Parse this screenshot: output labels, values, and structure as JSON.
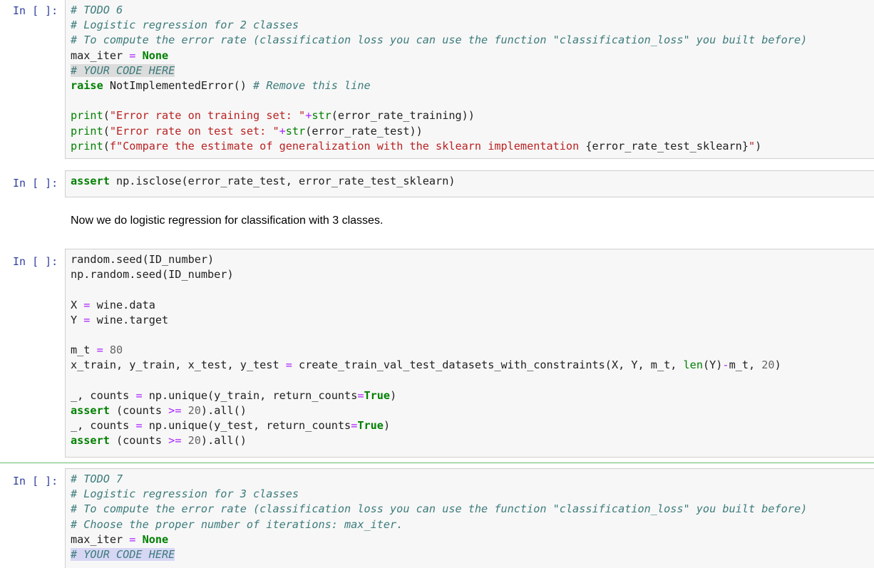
{
  "cells": [
    {
      "prompt": "In [ ]:",
      "lines": [
        [
          {
            "t": "# TODO 6",
            "c": "c"
          }
        ],
        [
          {
            "t": "# Logistic regression for 2 classes",
            "c": "c"
          }
        ],
        [
          {
            "t": "# To compute the error rate (classification loss you can use the function \"classification_loss\" you built before)",
            "c": "c"
          }
        ],
        [
          {
            "t": "max_iter "
          },
          {
            "t": "=",
            "c": "o"
          },
          {
            "t": " "
          },
          {
            "t": "None",
            "c": "k"
          }
        ],
        [
          {
            "t": "# YOUR CODE HERE",
            "c": "c hl"
          }
        ],
        [
          {
            "t": "raise",
            "c": "k"
          },
          {
            "t": " NotImplementedError() "
          },
          {
            "t": "# Remove this line",
            "c": "c"
          }
        ],
        [
          {
            "t": ""
          }
        ],
        [
          {
            "t": "print",
            "c": "b"
          },
          {
            "t": "("
          },
          {
            "t": "\"Error rate on training set: \"",
            "c": "s"
          },
          {
            "t": "+",
            "c": "o"
          },
          {
            "t": "str",
            "c": "b"
          },
          {
            "t": "(error_rate_training))"
          }
        ],
        [
          {
            "t": "print",
            "c": "b"
          },
          {
            "t": "("
          },
          {
            "t": "\"Error rate on test set: \"",
            "c": "s"
          },
          {
            "t": "+",
            "c": "o"
          },
          {
            "t": "str",
            "c": "b"
          },
          {
            "t": "(error_rate_test))"
          }
        ],
        [
          {
            "t": "print",
            "c": "b"
          },
          {
            "t": "("
          },
          {
            "t": "f\"Compare the estimate of generalization with the sklearn implementation ",
            "c": "s"
          },
          {
            "t": "{error_rate_test_sklearn}"
          },
          {
            "t": "\"",
            "c": "s"
          },
          {
            "t": ")"
          }
        ]
      ]
    },
    {
      "prompt": "In [ ]:",
      "lines": [
        [
          {
            "t": "assert",
            "c": "k"
          },
          {
            "t": " np.isclose(error_rate_test, error_rate_test_sklearn)"
          }
        ]
      ]
    },
    {
      "markdown": "Now we do logistic regression for classification with 3 classes."
    },
    {
      "prompt": "In [ ]:",
      "lines": [
        [
          {
            "t": "random.seed(ID_number)"
          }
        ],
        [
          {
            "t": "np.random.seed(ID_number)"
          }
        ],
        [
          {
            "t": ""
          }
        ],
        [
          {
            "t": "X "
          },
          {
            "t": "=",
            "c": "o"
          },
          {
            "t": " wine.data"
          }
        ],
        [
          {
            "t": "Y "
          },
          {
            "t": "=",
            "c": "o"
          },
          {
            "t": " wine.target"
          }
        ],
        [
          {
            "t": ""
          }
        ],
        [
          {
            "t": "m_t "
          },
          {
            "t": "=",
            "c": "o"
          },
          {
            "t": " "
          },
          {
            "t": "80",
            "c": "n"
          }
        ],
        [
          {
            "t": "x_train, y_train, x_test, y_test "
          },
          {
            "t": "=",
            "c": "o"
          },
          {
            "t": " create_train_val_test_datasets_with_constraints(X, Y, m_t, "
          },
          {
            "t": "len",
            "c": "b"
          },
          {
            "t": "(Y)"
          },
          {
            "t": "-",
            "c": "o"
          },
          {
            "t": "m_t, "
          },
          {
            "t": "20",
            "c": "n"
          },
          {
            "t": ")"
          }
        ],
        [
          {
            "t": ""
          }
        ],
        [
          {
            "t": "_, counts "
          },
          {
            "t": "=",
            "c": "o"
          },
          {
            "t": " np.unique(y_train, return_counts"
          },
          {
            "t": "=",
            "c": "o"
          },
          {
            "t": "True",
            "c": "k"
          },
          {
            "t": ")"
          }
        ],
        [
          {
            "t": "assert",
            "c": "k"
          },
          {
            "t": " (counts "
          },
          {
            "t": ">=",
            "c": "o"
          },
          {
            "t": " "
          },
          {
            "t": "20",
            "c": "n"
          },
          {
            "t": ").all()"
          }
        ],
        [
          {
            "t": "_, counts "
          },
          {
            "t": "=",
            "c": "o"
          },
          {
            "t": " np.unique(y_test, return_counts"
          },
          {
            "t": "=",
            "c": "o"
          },
          {
            "t": "True",
            "c": "k"
          },
          {
            "t": ")"
          }
        ],
        [
          {
            "t": "assert",
            "c": "k"
          },
          {
            "t": " (counts "
          },
          {
            "t": ">=",
            "c": "o"
          },
          {
            "t": " "
          },
          {
            "t": "20",
            "c": "n"
          },
          {
            "t": ").all()"
          }
        ]
      ]
    },
    {
      "prompt": "In [ ]:",
      "lines": [
        [
          {
            "t": "# TODO 7",
            "c": "c"
          }
        ],
        [
          {
            "t": "# Logistic regression for 3 classes",
            "c": "c"
          }
        ],
        [
          {
            "t": "# To compute the error rate (classification loss you can use the function \"classification_loss\" you built before)",
            "c": "c"
          }
        ],
        [
          {
            "t": "# Choose the proper number of iterations: max_iter.",
            "c": "c"
          }
        ],
        [
          {
            "t": "max_iter "
          },
          {
            "t": "=",
            "c": "o"
          },
          {
            "t": " "
          },
          {
            "t": "None",
            "c": "k"
          }
        ],
        [
          {
            "t": "# YOUR CODE HERE",
            "c": "c hl2"
          }
        ]
      ]
    }
  ]
}
